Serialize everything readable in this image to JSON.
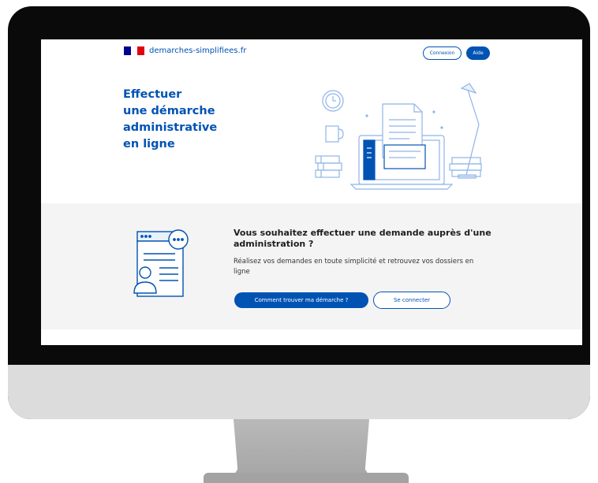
{
  "header": {
    "brand": "demarches-simplifiees.fr",
    "connexion_label": "Connexion",
    "aide_label": "Aide"
  },
  "hero": {
    "title_lines": [
      "Effectuer",
      "une démarche",
      "administrative",
      "en ligne"
    ]
  },
  "info": {
    "title": "Vous souhaitez effectuer une demande auprès d'une administration ?",
    "text": "Réalisez vos demandes en toute simplicité et retrouvez vos dossiers en ligne",
    "primary_button": "Comment trouver ma démarche ?",
    "secondary_button": "Se connecter"
  },
  "colors": {
    "brand_blue": "#0053b3",
    "flag_blue": "#000091",
    "flag_red": "#e1000f",
    "section_bg": "#f4f4f4"
  },
  "icons": {
    "hero": "laptop-documents-illustration",
    "info": "user-form-chat-illustration"
  }
}
